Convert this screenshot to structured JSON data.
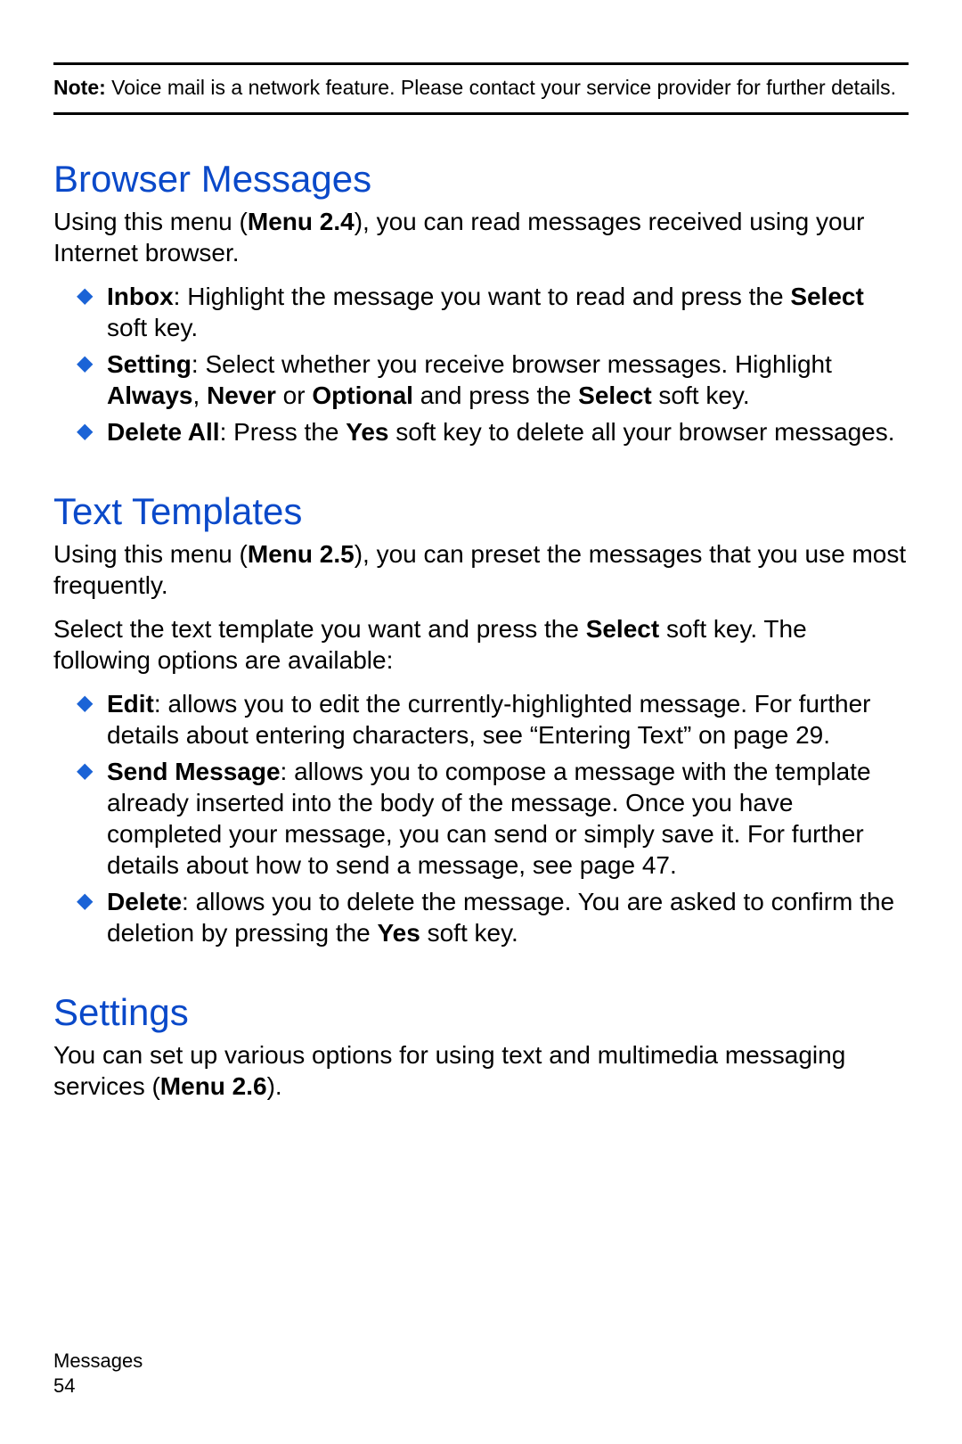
{
  "note": {
    "label": "Note:",
    "text": " Voice mail is a network feature. Please contact your service provider for further details."
  },
  "browser_messages": {
    "heading": "Browser Messages",
    "intro_pre": "Using this menu (",
    "intro_bold": "Menu 2.4",
    "intro_post": "), you can read messages received using your Internet browser.",
    "inbox": {
      "label": "Inbox",
      "mid1": ": Highlight the message you want to read and press the ",
      "bold1": "Select",
      "tail": " soft key."
    },
    "setting": {
      "label": "Setting",
      "mid1": ": Select whether you receive browser messages. Highlight ",
      "b1": "Always",
      "sep1": ", ",
      "b2": "Never",
      "sep2": " or ",
      "b3": "Optional",
      "mid2": " and press the ",
      "b4": "Select",
      "tail": " soft key."
    },
    "delete_all": {
      "label": "Delete All",
      "mid1": ": Press the ",
      "b1": "Yes",
      "tail": " soft key to delete all your browser messages."
    }
  },
  "text_templates": {
    "heading": "Text Templates",
    "intro_pre": "Using this menu (",
    "intro_bold": "Menu 2.5",
    "intro_post": "), you can preset the messages that you use most frequently.",
    "line2_pre": "Select the text template you want and press the ",
    "line2_bold": "Select",
    "line2_post": " soft key. The following options are available:",
    "edit": {
      "label": "Edit",
      "text": ": allows you to edit the currently-highlighted message. For further details about entering characters, see “Entering Text” on page 29."
    },
    "send": {
      "label": "Send Message",
      "text": ": allows you to compose a message with the template already inserted into the body of the message. Once you have completed your message, you can send or simply save it. For further details about how to send a message, see page 47."
    },
    "del": {
      "label": "Delete",
      "mid1": ": allows you to delete the message. You are asked to confirm the deletion by pressing the ",
      "b1": "Yes",
      "tail": " soft key."
    }
  },
  "settings": {
    "heading": "Settings",
    "intro_pre": "You can set up various options for using text and multimedia messaging services (",
    "intro_bold": "Menu 2.6",
    "intro_post": ")."
  },
  "footer": {
    "section": "Messages",
    "page": "54"
  }
}
